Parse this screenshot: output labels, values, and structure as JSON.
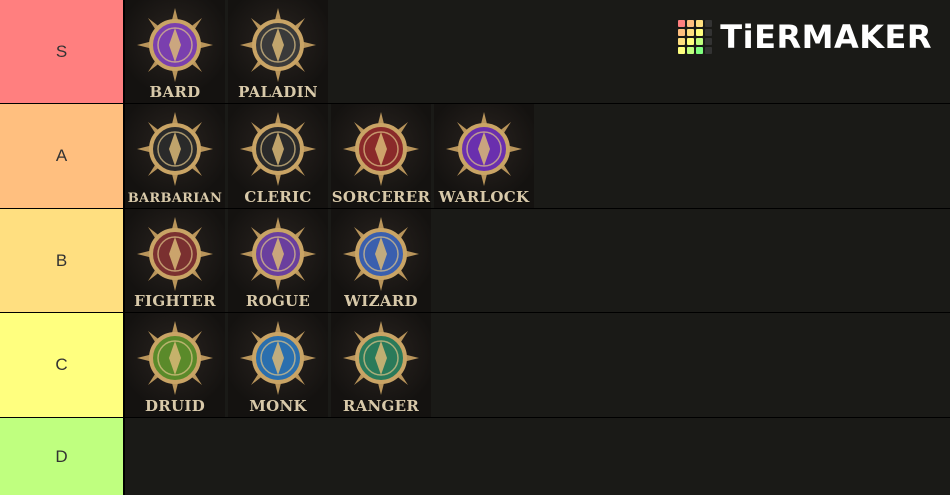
{
  "tiers": [
    {
      "label": "S",
      "color": "#ff7f7f",
      "items": [
        "BARD",
        "PALADIN"
      ]
    },
    {
      "label": "A",
      "color": "#ffbf7f",
      "items": [
        "BARBARIAN",
        "CLERIC",
        "SORCERER",
        "WARLOCK"
      ]
    },
    {
      "label": "B",
      "color": "#ffdf80",
      "items": [
        "FIGHTER",
        "ROGUE",
        "WIZARD"
      ]
    },
    {
      "label": "C",
      "color": "#ffff7f",
      "items": [
        "DRUID",
        "MONK",
        "RANGER"
      ]
    },
    {
      "label": "D",
      "color": "#bfff7f",
      "items": []
    }
  ],
  "logo": {
    "text": "TiERMAKER",
    "grid_colors": [
      "#ff7f7f",
      "#ffbf7f",
      "#ffdf80",
      "#333333",
      "#ffbf7f",
      "#ffdf80",
      "#ffff7f",
      "#333333",
      "#ffdf80",
      "#ffff7f",
      "#bfff7f",
      "#333333",
      "#ffff7f",
      "#bfff7f",
      "#7fff7f",
      "#333333"
    ]
  },
  "emblem_colors": {
    "BARD": "#7a3fae",
    "PALADIN": "#3a3a3a",
    "BARBARIAN": "#2a2a2a",
    "CLERIC": "#2a2a2a",
    "SORCERER": "#8a2a2a",
    "WARLOCK": "#6a2fae",
    "FIGHTER": "#7a3030",
    "ROGUE": "#6a3f9e",
    "WIZARD": "#3a5fae",
    "DRUID": "#5a8a2a",
    "MONK": "#2a6fae",
    "RANGER": "#2a7a5a"
  }
}
